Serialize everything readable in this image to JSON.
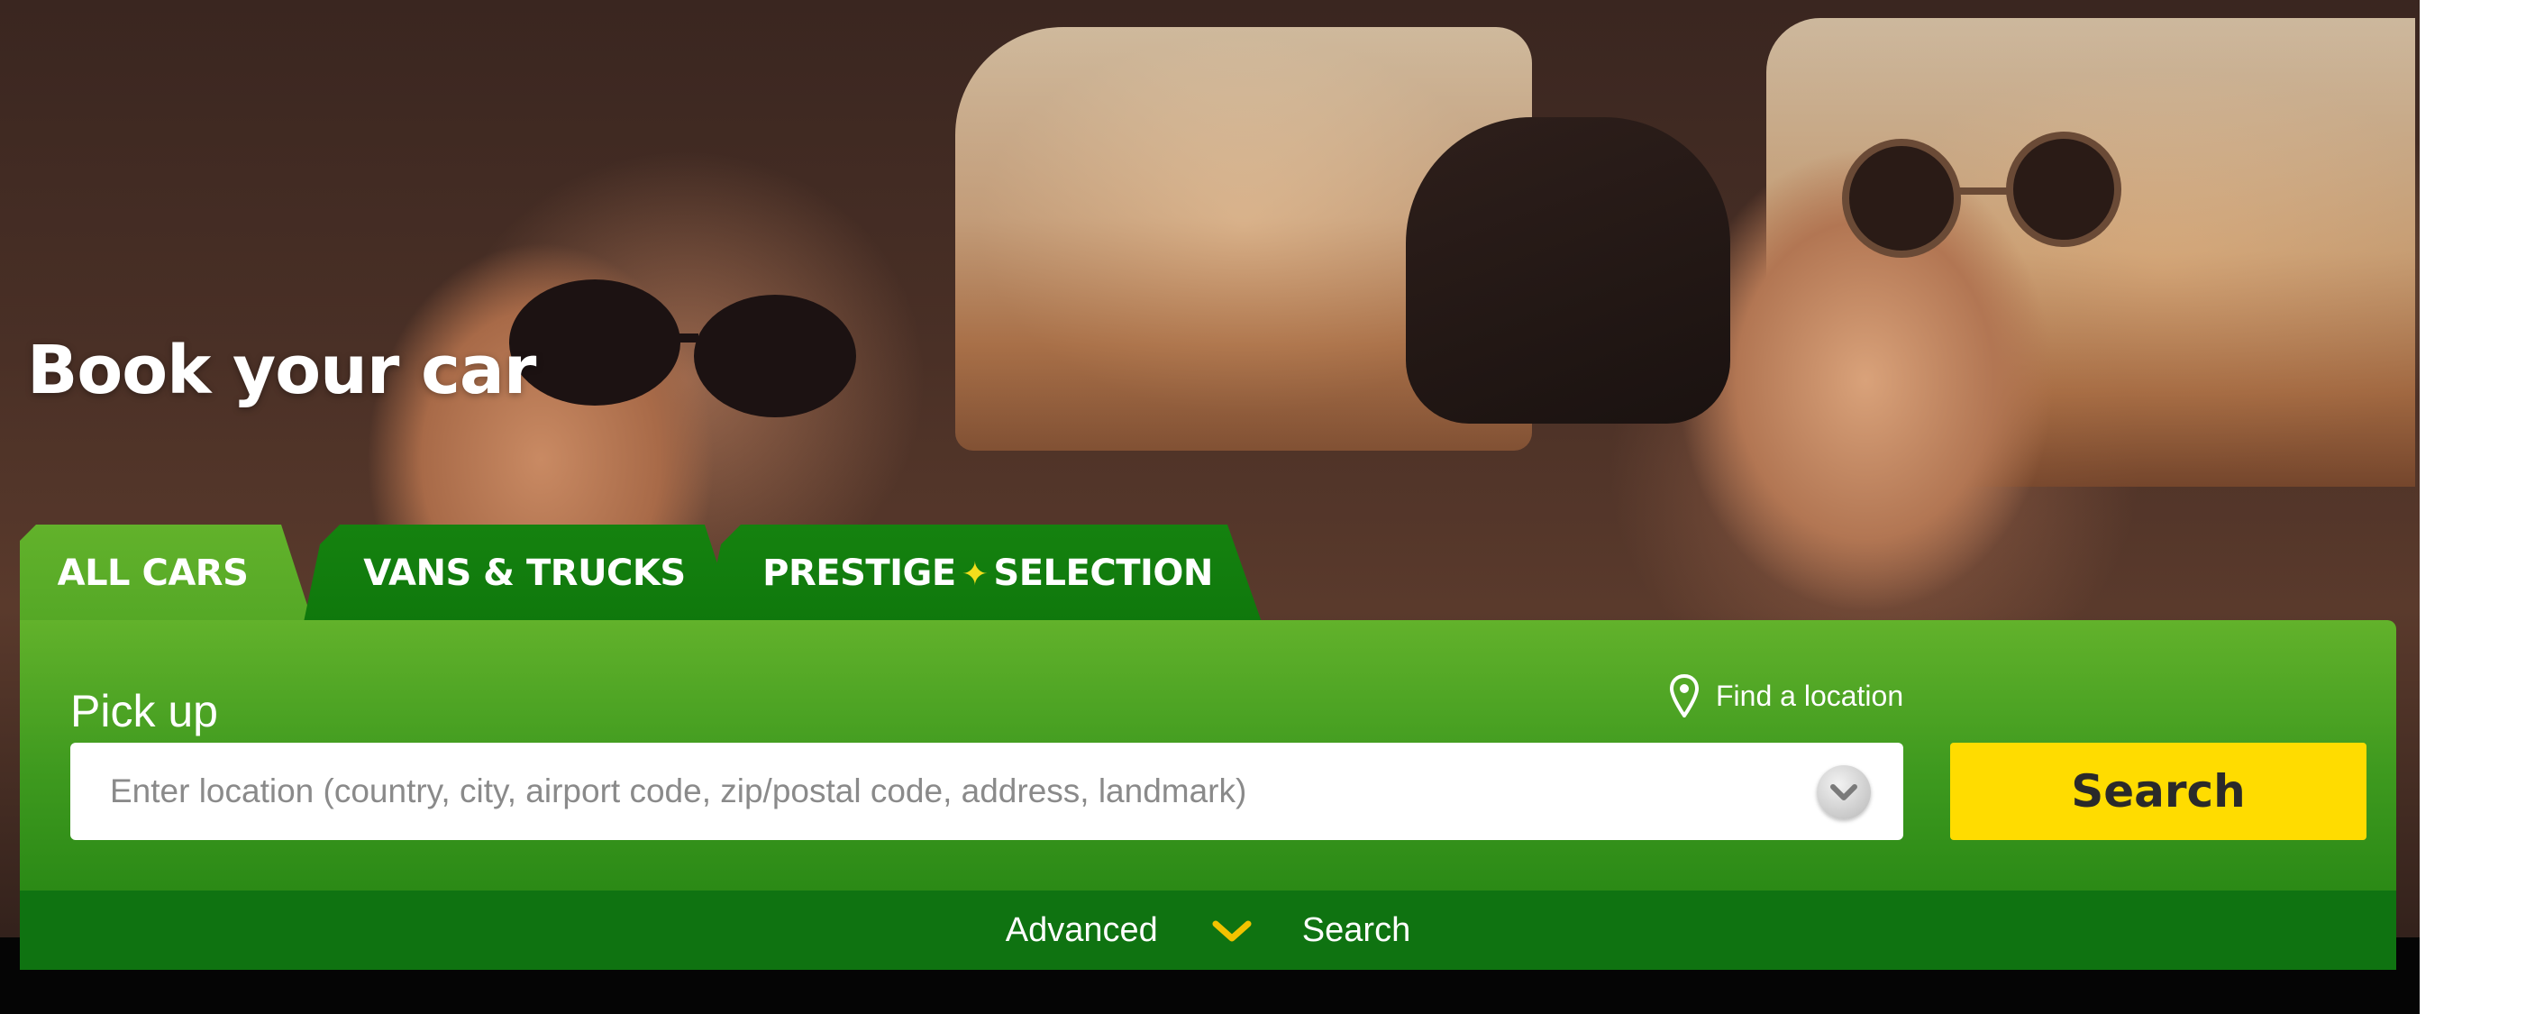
{
  "hero": {
    "title": "Book your car"
  },
  "tabs": [
    {
      "label": "ALL CARS",
      "active": true
    },
    {
      "label": "VANS & TRUCKS",
      "active": false
    },
    {
      "label_part1": "PRESTIGE",
      "star": "✦",
      "label_part2": "SELECTION",
      "active": false
    }
  ],
  "search_panel": {
    "pickup_label": "Pick up",
    "find_location": "Find a location",
    "location_placeholder": "Enter location (country, city, airport code, zip/postal code, address, landmark)",
    "location_value": "",
    "search_button": "Search"
  },
  "advanced": {
    "left_text": "Advanced",
    "right_text": "Search"
  },
  "colors": {
    "brand_green": "#62b22b",
    "dark_green": "#0f7311",
    "search_yellow": "#ffdc00",
    "star_yellow": "#f2de1c"
  },
  "icons": {
    "location_pin": "map-pin-icon",
    "dropdown": "chevron-down-icon",
    "advanced_toggle": "chevron-down-icon"
  }
}
